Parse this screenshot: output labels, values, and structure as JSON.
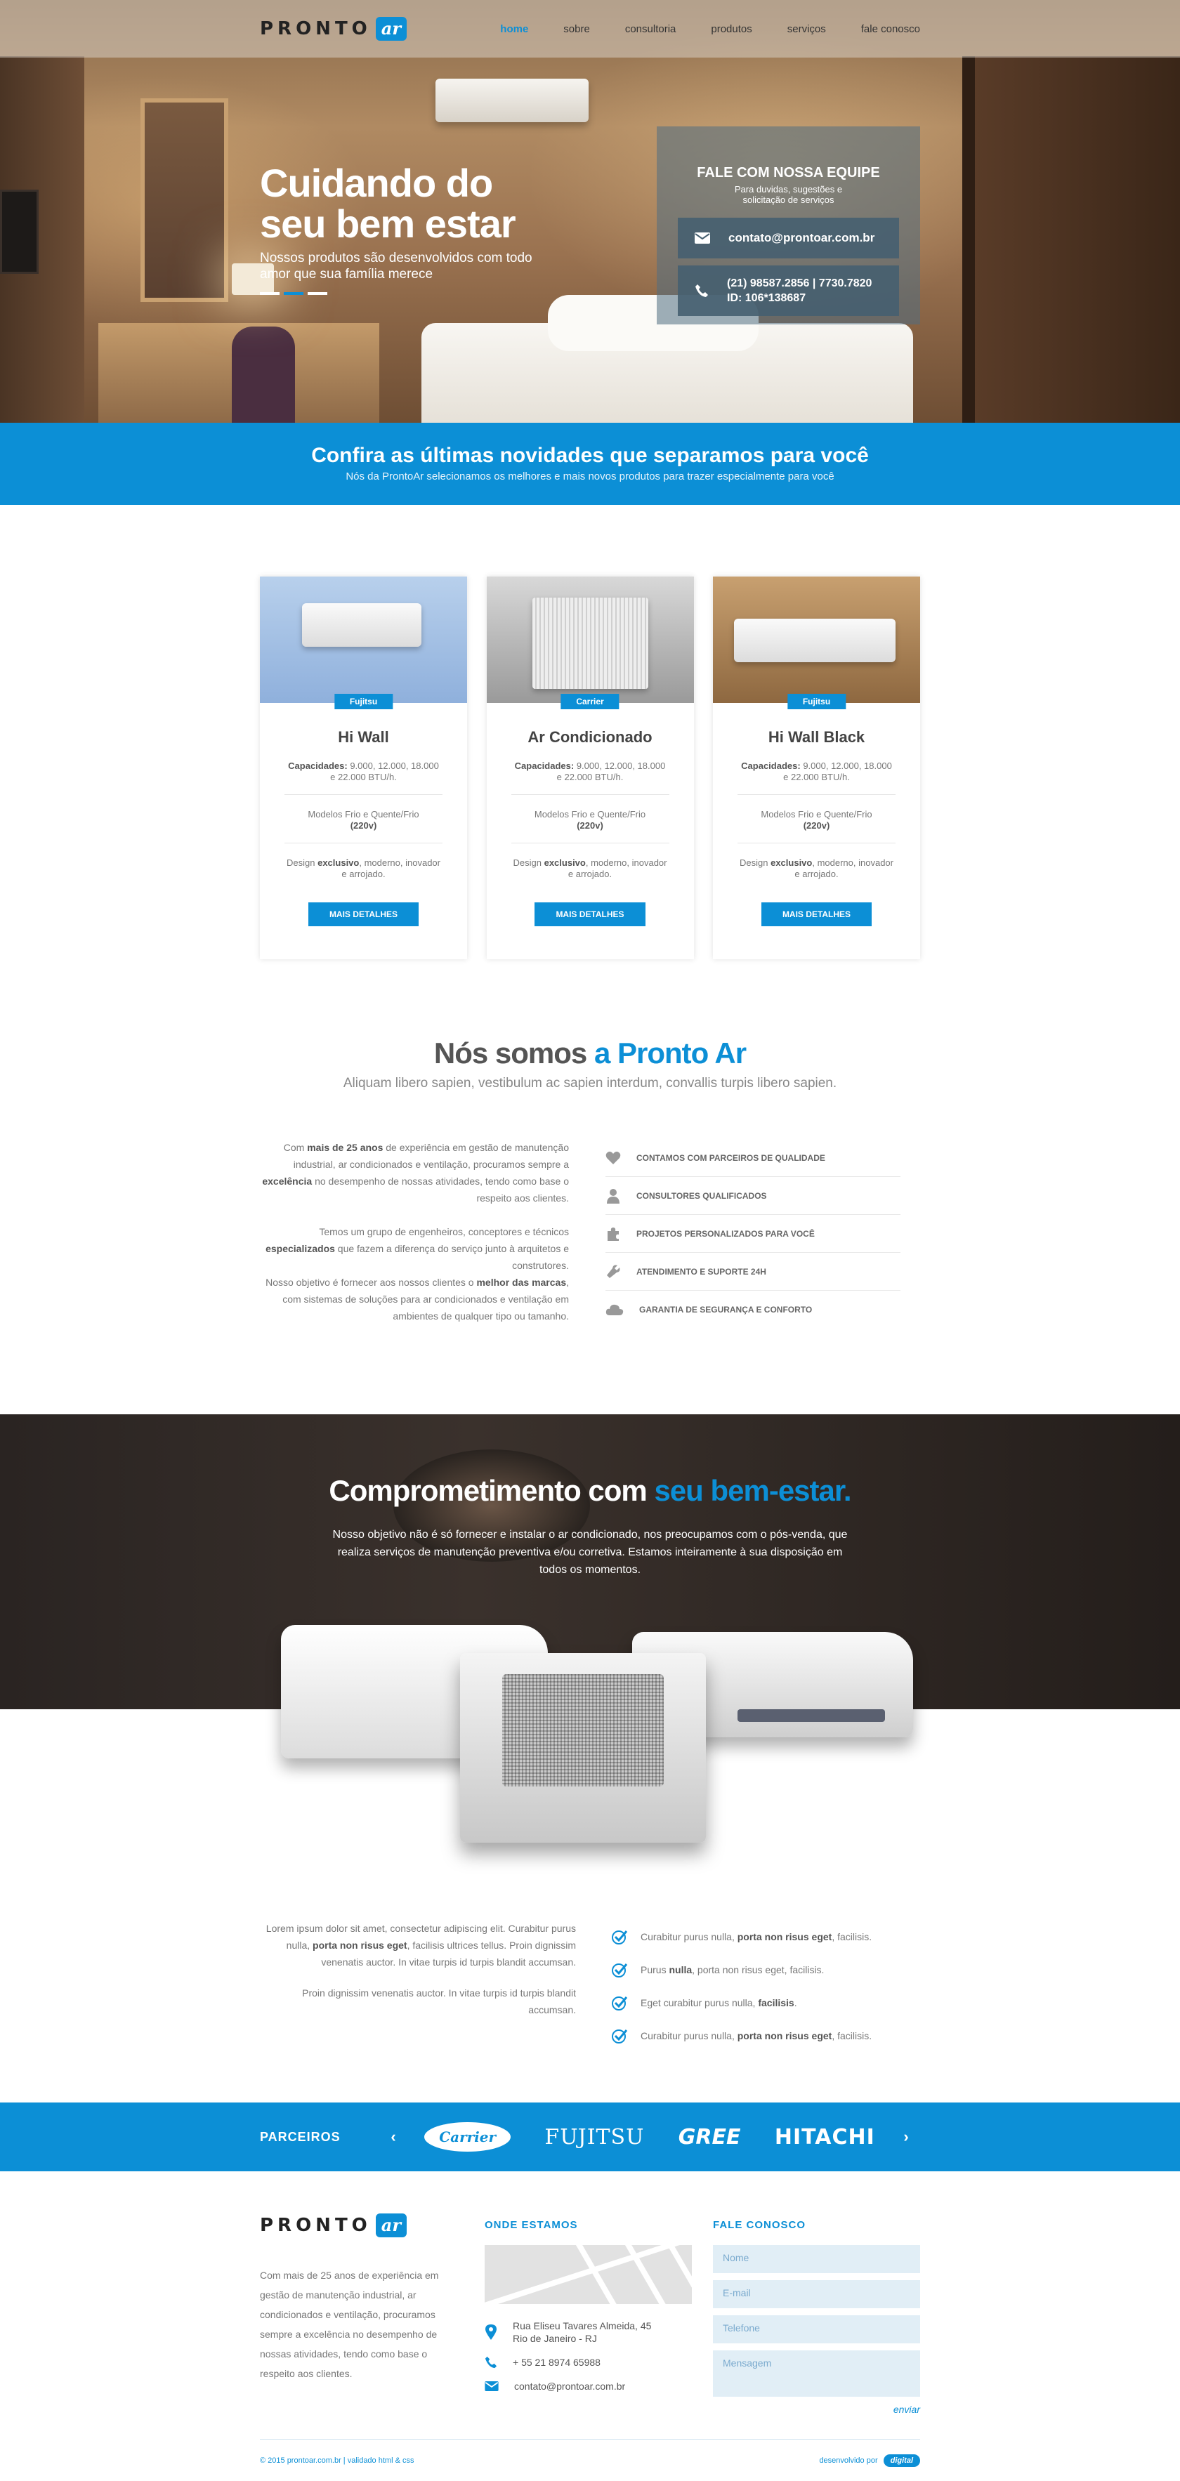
{
  "nav": {
    "brand": "PRONTO",
    "brand_badge": "ar",
    "items": [
      "home",
      "sobre",
      "consultoria",
      "produtos",
      "serviços",
      "fale conosco"
    ]
  },
  "hero": {
    "title_line1": "Cuidando do",
    "title_line2": "seu bem estar",
    "subtitle": "Nossos produtos são desenvolvidos com todo amor que sua família merece",
    "slider_dots": 3,
    "slider_active": 2
  },
  "contact_box": {
    "title": "FALE COM NOSSA EQUIPE",
    "subtitle": "Para duvidas, sugestões e solicitação de serviços",
    "email": "contato@prontoar.com.br",
    "phone": "(21) 98587.2856 | 7730.7820",
    "id": "ID: 106*138687"
  },
  "promo": {
    "title": "Confira as últimas novidades que separamos para você",
    "subtitle": "Nós da ProntoAr selecionamos os melhores e mais novos produtos para trazer especialmente para você"
  },
  "products": [
    {
      "brand": "Fujitsu",
      "name": "Hi Wall",
      "cap_label": "Capacidades:",
      "cap": " 9.000, 12.000, 18.000 e 22.000 BTU/h.",
      "models": "Modelos Frio e Quente/Frio",
      "voltage": "(220v)",
      "d1": "Design ",
      "d2": "exclusivo",
      "d3": ", moderno, inovador e arrojado.",
      "button": "MAIS DETALHES"
    },
    {
      "brand": "Carrier",
      "name": "Ar Condicionado",
      "cap_label": "Capacidades:",
      "cap": " 9.000, 12.000, 18.000 e 22.000 BTU/h.",
      "models": "Modelos Frio e Quente/Frio",
      "voltage": "(220v)",
      "d1": "Design ",
      "d2": "exclusivo",
      "d3": ", moderno, inovador e arrojado.",
      "button": "MAIS DETALHES"
    },
    {
      "brand": "Fujitsu",
      "name": "Hi Wall Black",
      "cap_label": "Capacidades:",
      "cap": " 9.000, 12.000, 18.000 e 22.000 BTU/h.",
      "models": "Modelos Frio e Quente/Frio",
      "voltage": "(220v)",
      "d1": "Design ",
      "d2": "exclusivo",
      "d3": ", moderno, inovador e arrojado.",
      "button": "MAIS DETALHES"
    }
  ],
  "about": {
    "title_a": "Nós somos ",
    "title_b": "a Pronto Ar",
    "lead": "Aliquam libero sapien, vestibulum ac sapien interdum, convallis turpis libero sapien.",
    "p1_a": "Com ",
    "p1_b": "mais de 25 anos",
    "p1_c": " de experiência em gestão de manutenção industrial, ar condicionados e ventilação, procuramos sempre a ",
    "p1_d": "excelência",
    "p1_e": " no desempenho de nossas atividades, tendo como base o respeito aos clientes.",
    "p2_a": "Temos um grupo de engenheiros, conceptores e técnicos ",
    "p2_b": "especializados",
    "p2_c": " que fazem a diferença do serviço junto à arquitetos e construtores.",
    "p3_a": "Nosso objetivo é fornecer aos nossos clientes o ",
    "p3_b": "melhor das marcas",
    "p3_c": ", com sistemas de soluções para  ar condicionados e ventilação em ambientes de qualquer tipo ou tamanho.",
    "features": [
      {
        "icon": "heart-icon",
        "label": "CONTAMOS COM PARCEIROS DE QUALIDADE"
      },
      {
        "icon": "user-icon",
        "label": "CONSULTORES QUALIFICADOS"
      },
      {
        "icon": "puzzle-icon",
        "label": "PROJETOS PERSONALIZADOS PARA VOCÊ"
      },
      {
        "icon": "wrench-icon",
        "label": "ATENDIMENTO E SUPORTE 24H"
      },
      {
        "icon": "cloud-icon",
        "label": "GARANTIA DE SEGURANÇA E CONFORTO"
      }
    ]
  },
  "commit": {
    "title_a": "Comprometimento com ",
    "title_b": "seu bem-estar.",
    "text": "Nosso objetivo não é só fornecer e instalar o ar condicionado, nos preocupamos com o pós-venda, que realiza serviços de manutenção preventiva e/ou corretiva. Estamos inteiramente à sua disposição em todos os momentos."
  },
  "lorem": {
    "p1_a": "Lorem ipsum dolor sit amet, consectetur adipiscing elit. Curabitur purus nulla, ",
    "p1_b": "porta non risus eget",
    "p1_c": ", facilisis ultrices tellus. Proin dignissim venenatis auctor. In vitae turpis id turpis blandit accumsan.",
    "p2": "Proin dignissim venenatis auctor. In vitae turpis id turpis blandit accumsan.",
    "checks": [
      {
        "a": "Curabitur purus nulla, ",
        "b": "porta non risus eget",
        "c": ", facilisis."
      },
      {
        "a": "Purus ",
        "b": "nulla",
        "c": ", porta non risus eget, facilisis."
      },
      {
        "a": "Eget curabitur purus nulla, ",
        "b": "facilisis",
        "c": "."
      },
      {
        "a": "Curabitur purus nulla, ",
        "b": "porta non risus eget",
        "c": ", facilisis."
      }
    ]
  },
  "partners": {
    "label": "PARCEIROS",
    "prev": "‹",
    "next": "›",
    "brands": [
      "Carrier",
      "FUJITSU",
      "GREE",
      "HITACHI"
    ]
  },
  "footer": {
    "about": "Com mais de 25 anos de experiência em gestão de manutenção industrial, ar condicionados e ventilação, procuramos sempre a excelência no desempenho de nossas atividades, tendo como base o respeito aos clientes.",
    "where_title": "ONDE ESTAMOS",
    "address1": "Rua Eliseu Tavares Almeida, 45",
    "address2": "Rio de Janeiro - RJ",
    "phone": "+ 55 21 8974 65988",
    "email": "contato@prontoar.com.br",
    "contact_title": "FALE CONOSCO",
    "ph_name": "Nome",
    "ph_email": "E-mail",
    "ph_phone": "Telefone",
    "ph_message": "Mensagem",
    "send": "enviar",
    "copyright": "© 2015 prontoar.com.br | validado html & css",
    "dev_label": "desenvolvido por",
    "dev_brand": "digital"
  },
  "colors": {
    "accent": "#0c8fd6"
  }
}
